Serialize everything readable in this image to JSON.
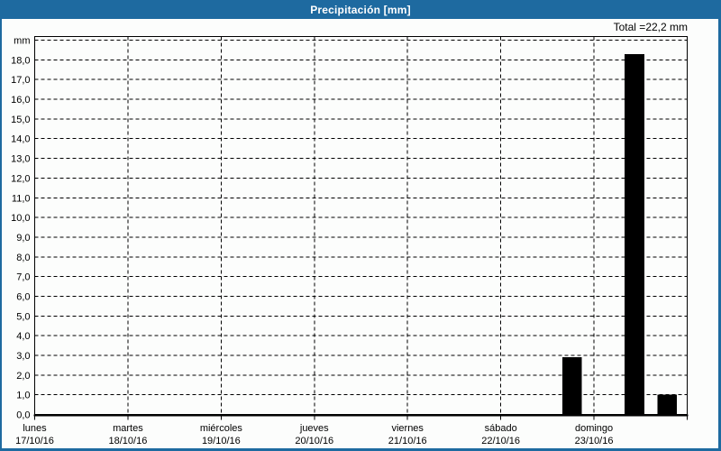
{
  "titlebar": {
    "title": "Precipitación [mm]"
  },
  "colors": {
    "frame": "#1e6aa0",
    "title_text": "#ffffff",
    "bar": "#000000",
    "grid": "#000000",
    "plot_bg": "#fcfdfc"
  },
  "chart_data": {
    "type": "bar",
    "title": "Precipitación [mm]",
    "total_label": "Total =22,2 mm",
    "total_mm": 22.2,
    "unit_label": "mm",
    "xlabel": "",
    "ylabel": "mm",
    "ylim": [
      0,
      19.2
    ],
    "y_tick_step": 1.0,
    "grid": "dashed",
    "legend": "none",
    "y_tick_labels": [
      "0,0",
      "1,0",
      "2,0",
      "3,0",
      "4,0",
      "5,0",
      "6,0",
      "7,0",
      "8,0",
      "9,0",
      "10,0",
      "11,0",
      "12,0",
      "13,0",
      "14,0",
      "15,0",
      "16,0",
      "17,0",
      "18,0"
    ],
    "categories": [
      {
        "weekday": "lunes",
        "date": "17/10/16"
      },
      {
        "weekday": "martes",
        "date": "18/10/16"
      },
      {
        "weekday": "miércoles",
        "date": "19/10/16"
      },
      {
        "weekday": "jueves",
        "date": "20/10/16"
      },
      {
        "weekday": "viernes",
        "date": "21/10/16"
      },
      {
        "weekday": "sábado",
        "date": "22/10/16"
      },
      {
        "weekday": "domingo",
        "date": "23/10/16"
      }
    ],
    "bars": [
      {
        "date": "22/10/16",
        "value_mm": 2.9,
        "day_offset": 5.66,
        "width_days": 0.21
      },
      {
        "date": "23/10/16",
        "value_mm": 18.3,
        "day_offset": 6.33,
        "width_days": 0.21
      },
      {
        "date": "23/10/16",
        "value_mm": 1.0,
        "day_offset": 6.68,
        "width_days": 0.21
      }
    ]
  }
}
